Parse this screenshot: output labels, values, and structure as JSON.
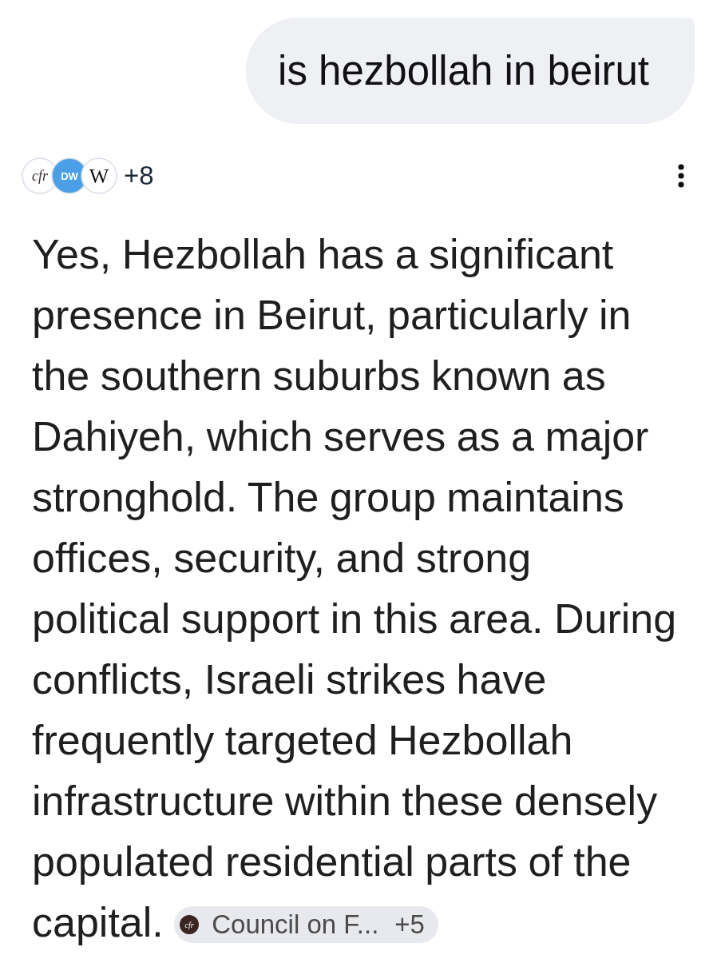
{
  "query": {
    "text": "is hezbollah in beirut"
  },
  "sources": {
    "logos": [
      {
        "kind": "cfr",
        "text": "cfr"
      },
      {
        "kind": "dw",
        "text": "DW"
      },
      {
        "kind": "wiki",
        "text": "W"
      }
    ],
    "more": "+8"
  },
  "answer": {
    "text": "Yes, Hezbollah has a significant presence in Beirut, particularly in the southern suburbs known as Dahiyeh, which serves as a major stronghold. The group maintains offices, security, and strong political support in this area. During conflicts, Israeli strikes have frequently targeted Hezbollah infrastructure within these densely populated residential parts of the capital.",
    "citation": {
      "logo": "cfr",
      "label": "Council on F...",
      "more": "+5"
    }
  }
}
